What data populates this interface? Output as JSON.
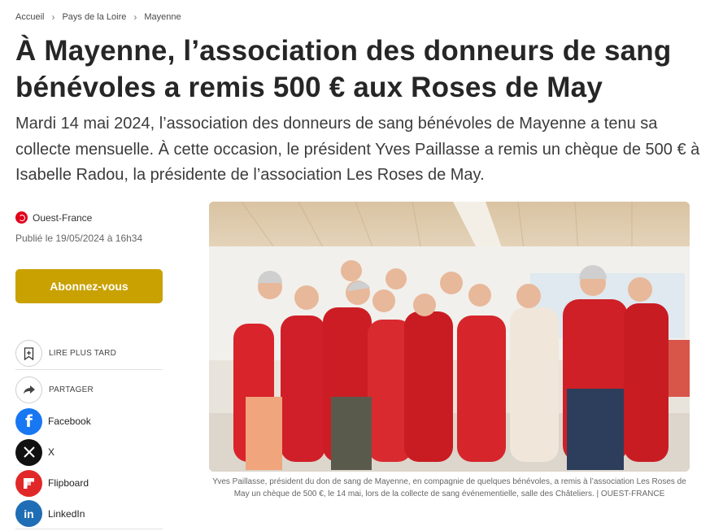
{
  "breadcrumb": {
    "items": [
      "Accueil",
      "Pays de la Loire",
      "Mayenne"
    ]
  },
  "article": {
    "title": "À Mayenne, l’association des donneurs de sang bénévoles a remis 500 € aux Roses de May",
    "lead": "Mardi 14 mai 2024, l’association des donneurs de sang bénévoles de Mayenne a tenu sa collecte mensuelle. À cette occasion, le président Yves Paillasse a remis un chèque de 500 € à Isabelle Radou, la présidente de l’association Les Roses de May.",
    "source": "Ouest-France",
    "published": "Publié le 19/05/2024 à 16h34",
    "caption": "Yves Paillasse, président du don de sang de Mayenne, en compagnie de quelques bénévoles, a remis à l’association Les Roses de May un chèque de 500 €, le 14 mai, lors de la collecte de sang événementielle, salle des Châteliers. | OUEST-FRANCE"
  },
  "subscribe": {
    "label": "Abonnez-vous"
  },
  "actions": {
    "read_later": "LIRE PLUS TARD",
    "share": "PARTAGER"
  },
  "social": {
    "facebook": "Facebook",
    "x": "X",
    "flipboard": "Flipboard",
    "linkedin": "LinkedIn"
  },
  "colors": {
    "brand_red": "#e2001a",
    "subscribe_gold": "#c9a100",
    "facebook": "#1877f2",
    "flipboard": "#e12828",
    "linkedin": "#1f6db5"
  },
  "icons": [
    "ouest-france-logo-icon",
    "bookmark-icon",
    "share-arrow-icon",
    "facebook-icon",
    "x-icon",
    "flipboard-icon",
    "linkedin-icon"
  ]
}
